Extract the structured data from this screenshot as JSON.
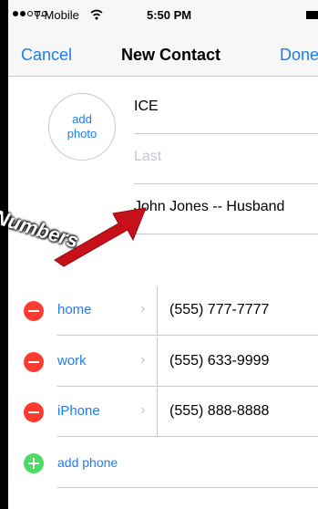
{
  "status_bar": {
    "carrier": "T-Mobile",
    "time": "5:50 PM",
    "signal_icon": "signal-dots-icon",
    "wifi_icon": "wifi-icon",
    "battery_icon": "battery-icon"
  },
  "nav": {
    "cancel_label": "Cancel",
    "title": "New Contact",
    "done_label": "Done"
  },
  "photo": {
    "label": "add photo"
  },
  "name": {
    "first": "ICE",
    "last_placeholder": "Last",
    "company": "John Jones -- Husband"
  },
  "phones": [
    {
      "label": "home",
      "number": "(555) 777-7777"
    },
    {
      "label": "work",
      "number": "(555) 633-9999"
    },
    {
      "label": "iPhone",
      "number": "(555) 888-8888"
    }
  ],
  "add_phone_label": "add phone",
  "annotation": {
    "text": "Numbers",
    "arrow_color": "#c8101a"
  },
  "colors": {
    "accent": "#1e7cf2",
    "delete": "#ff3b30",
    "add": "#4cd964"
  }
}
